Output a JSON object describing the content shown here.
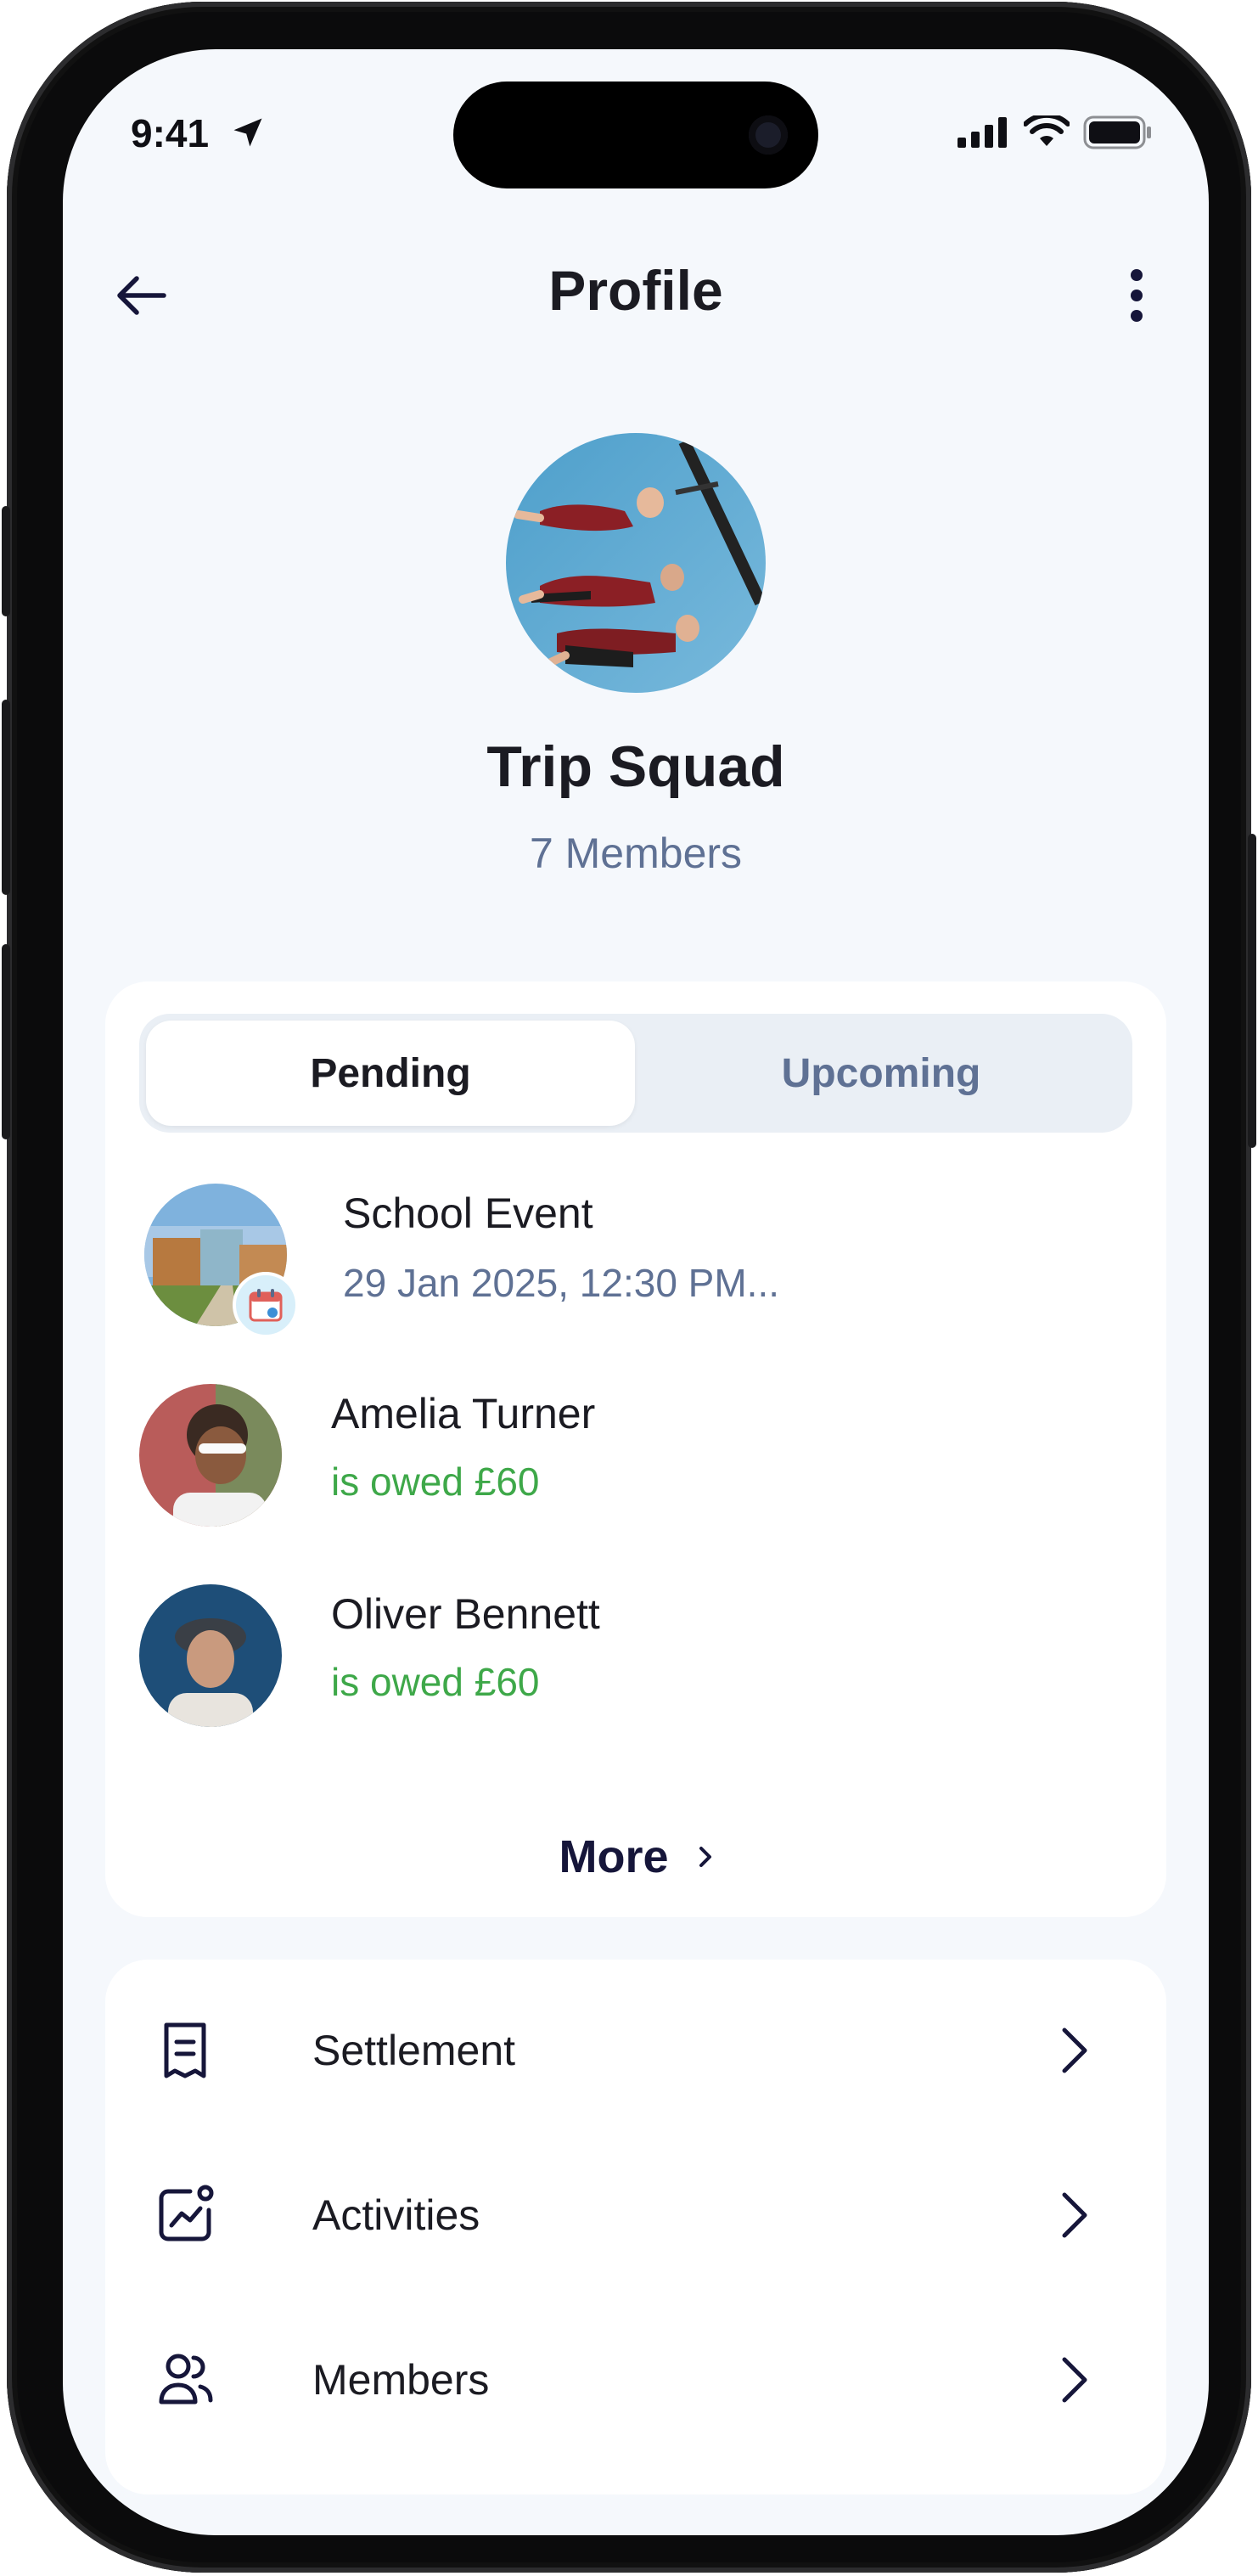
{
  "status_bar": {
    "time": "9:41"
  },
  "header": {
    "title": "Profile",
    "back_icon": "arrow-left-icon",
    "menu_icon": "more-vertical-icon"
  },
  "group": {
    "name": "Trip Squad",
    "members": "7 Members"
  },
  "tabs": [
    {
      "label": "Pending",
      "active": true
    },
    {
      "label": "Upcoming",
      "active": false
    }
  ],
  "pending": [
    {
      "title": "School Event",
      "subtitle": "29 Jan 2025, 12:30 PM...",
      "badge_icon": "calendar-icon"
    },
    {
      "title": "Amelia Turner",
      "subtitle": "is owed £60"
    },
    {
      "title": "Oliver Bennett",
      "subtitle": "is owed £60"
    }
  ],
  "more_label": "More",
  "menu": [
    {
      "label": "Settlement",
      "icon": "receipt-icon"
    },
    {
      "label": "Activities",
      "icon": "activity-chart-icon"
    },
    {
      "label": "Members",
      "icon": "users-icon"
    }
  ],
  "colors": {
    "accent_text": "#5f7194",
    "owed_green": "#3ea849",
    "title_dark": "#1b1b22",
    "background": "#f5f8fc"
  }
}
